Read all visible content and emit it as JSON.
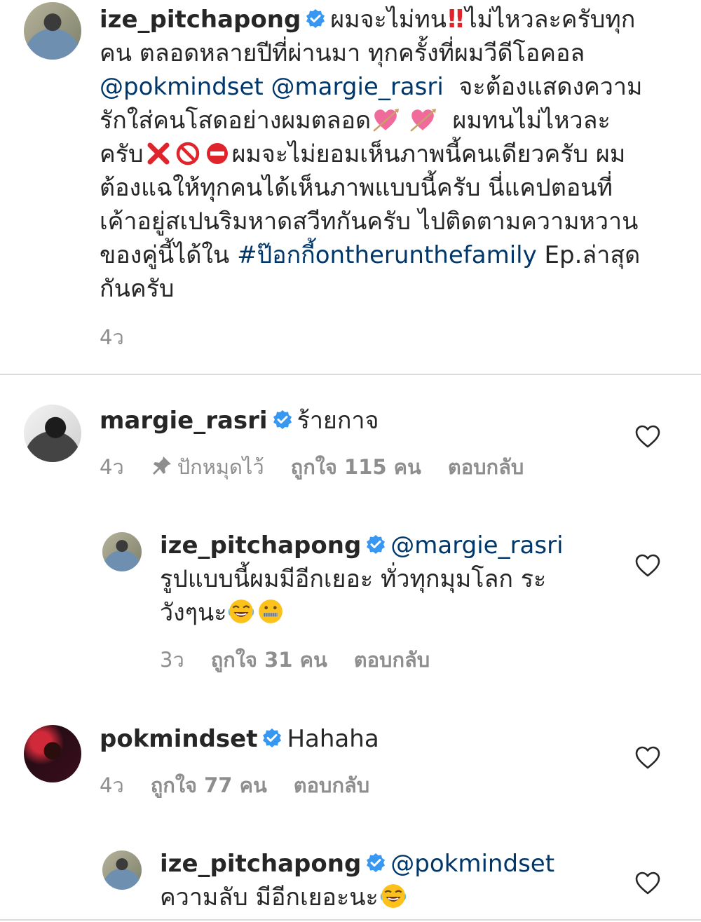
{
  "post": {
    "username": "ize_pitchapong",
    "line1": "ผมจะไม่ทน",
    "line1b": "ไม่ไหวละครับทุก",
    "line2": "คน ตลอดหลายปีที่ผ่านมา ทุกครั้งที่ผมวีดีโอคอล",
    "mention1": "@pokmindset",
    "mention2": "@margie_rasri",
    "line3b": "จะต้องแสดงความ",
    "line4": "รักใส่คนโสดอย่างผมตลอด",
    "line4b": "ผมทนไม่ไหวละ",
    "line5a": "ครับ",
    "line5b": "ผมจะไม่ยอมเห็นภาพนี้คนเดียวครับ ผม",
    "line6": "ต้องแฉให้ทุกคนได้เห็นภาพแบบนี้ครับ นี่แคปตอนที่",
    "line7": "เค้าอยู่สเปนริมหาดสวีทกันครับ ไปติดตามความหวาน",
    "line8a": "ของคู่นี้ได้ใน",
    "hashtag": "#ป๊อกกี้ontherunthefamily",
    "line8b": "Ep.ล่าสุด",
    "line9": "กันครับ",
    "time": "4ว"
  },
  "comments": [
    {
      "username": "margie_rasri",
      "text": "ร้ายกาจ",
      "time": "4ว",
      "pinned": "ปักหมุดไว้",
      "likes": "ถูกใจ 115 คน",
      "reply": "ตอบกลับ"
    },
    {
      "username": "ize_pitchapong",
      "mention": "@margie_rasri",
      "line1": "รูปแบบนี้ผมมีอีกเยอะ ทั่วทุกมุมโลก ระ",
      "line2": "วังๆนะ",
      "time": "3ว",
      "likes": "ถูกใจ 31 คน",
      "reply": "ตอบกลับ"
    },
    {
      "username": "pokmindset",
      "text": "Hahaha",
      "time": "4ว",
      "likes": "ถูกใจ 77 คน",
      "reply": "ตอบกลับ"
    },
    {
      "username": "ize_pitchapong",
      "mention": "@pokmindset",
      "line1": "ความลับ มีอีกเยอะนะ"
    }
  ],
  "colors": {
    "link": "#00376b",
    "verified": "#3897f0",
    "meta": "#8e8e8e",
    "text": "#262626"
  },
  "icons": [
    "verified-badge-icon",
    "double-exclamation-emoji",
    "heart-arrow-emoji",
    "cross-mark-emoji",
    "prohibited-emoji",
    "no-entry-emoji",
    "tears-of-joy-emoji",
    "zipper-mouth-emoji",
    "pin-icon",
    "heart-outline-icon"
  ]
}
